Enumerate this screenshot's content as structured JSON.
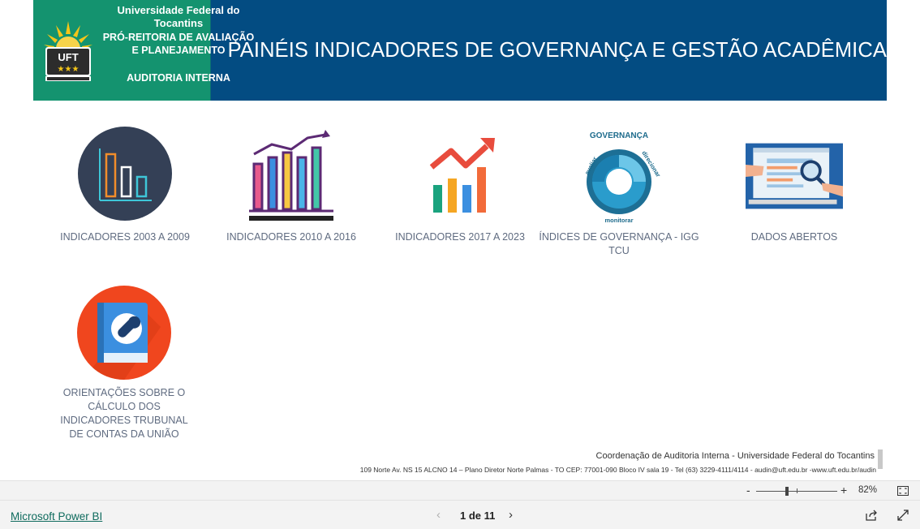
{
  "header": {
    "university": "Universidade Federal do Tocantins",
    "proreitoria": "PRÓ-REITORIA DE AVALIAÇÃO E PLANEJAMENTO",
    "audit": "AUDITORIA INTERNA",
    "logo_text": "UFT",
    "title": "PAINÉIS INDICADORES DE GOVERNANÇA E GESTÃO ACADÊMICA"
  },
  "tiles": [
    {
      "label": "INDICADORES 2003 A 2009",
      "icon": "bar-chart-circle-icon"
    },
    {
      "label": "INDICADORES 2010 A 2016",
      "icon": "growth-bar-chart-icon"
    },
    {
      "label": "INDICADORES 2017 A 2023",
      "icon": "trend-arrow-chart-icon"
    },
    {
      "label": "ÍNDICES DE GOVERNANÇA - IGG TCU",
      "icon": "governance-cycle-icon",
      "governance_title": "GOVERNANÇA",
      "word_avaliar": "avaliar",
      "word_direcionar": "direcionar",
      "word_monitorar": "monitorar"
    },
    {
      "label": "DADOS ABERTOS",
      "icon": "open-data-magnifier-icon"
    },
    {
      "label": "ORIENTAÇÕES SOBRE O CÁLCULO DOS INDICADORES TRUBUNAL DE CONTAS DA UNIÃO",
      "icon": "manual-wrench-icon"
    }
  ],
  "footer": {
    "line1": "Coordenação de Auditoria Interna - Universidade Federal do Tocantins",
    "line2": "109 Norte Av. NS 15 ALCNO 14 – Plano Diretor Norte Palmas - TO CEP: 77001-090 Bloco IV sala 19 - Tel (63) 3229-4111/4114 - audin@uft.edu.br -www.uft.edu.br/audin"
  },
  "zoom": {
    "minus": "-",
    "plus": "+",
    "level": "82%"
  },
  "bottom": {
    "powerbi_link": "Microsoft Power BI",
    "prev": "‹",
    "page_indicator": "1 de 11",
    "next": "›"
  },
  "colors": {
    "header_green": "#14936f",
    "header_blue": "#034c82",
    "label_gray": "#5f6b80",
    "link_teal": "#0f6b5e"
  }
}
